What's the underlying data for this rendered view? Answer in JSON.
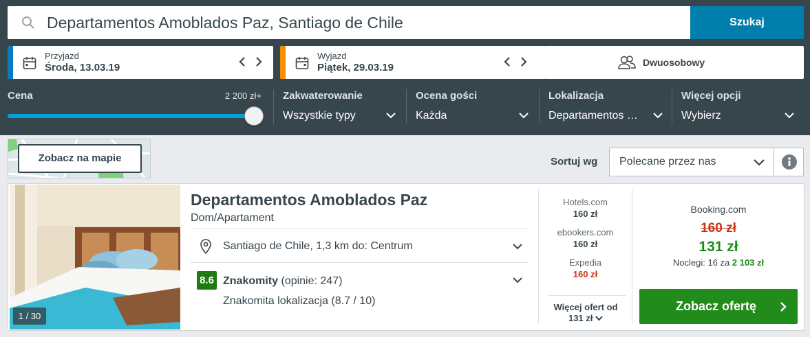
{
  "search": {
    "query": "Departamentos Amoblados Paz, Santiago de Chile",
    "button_label": "Szukaj"
  },
  "checkin": {
    "label": "Przyjazd",
    "date": "Środa, 13.03.19",
    "accent": "#0a7bbf"
  },
  "checkout": {
    "label": "Wyjazd",
    "date": "Piątek, 29.03.19",
    "accent": "#f48f00"
  },
  "guests": {
    "label": "Dwuosobowy"
  },
  "filters": {
    "price": {
      "label": "Cena",
      "max_label": "2 200 zł+",
      "level": 1.0
    },
    "accommodation": {
      "label": "Zakwaterowanie",
      "value": "Wszystkie typy"
    },
    "rating": {
      "label": "Ocena gości",
      "value": "Każda"
    },
    "location": {
      "label": "Lokalizacja",
      "value": "Departamentos …"
    },
    "more": {
      "label": "Więcej opcji",
      "value": "Wybierz"
    }
  },
  "map": {
    "button_label": "Zobacz na mapie"
  },
  "sort": {
    "label": "Sortuj wg",
    "value": "Polecane przez nas"
  },
  "hotel": {
    "name": "Departamentos Amoblados Paz",
    "type": "Dom/Apartament",
    "photo_counter": "1 / 30",
    "location": "Santiago de Chile, 1,3 km do: Centrum",
    "score": "8.6",
    "rating_word": "Znakomity",
    "reviews": "(opinie: 247)",
    "location_rating": "Znakomita lokalizacja (8.7 / 10)"
  },
  "other_prices": [
    {
      "site": "Hotels.com",
      "price": "160 zł"
    },
    {
      "site": "ebookers.com",
      "price": "160 zł"
    },
    {
      "site": "Expedia",
      "price": "160 zł"
    }
  ],
  "more_offers": {
    "line1": "Więcej ofert od",
    "line2": "131 zł"
  },
  "main_offer": {
    "site": "Booking.com",
    "old_price": "160 zł",
    "price": "131 zł",
    "nights_text": "Noclegi: 16 za",
    "total": "2 103 zł",
    "button_label": "Zobacz ofertę"
  },
  "colors": {
    "primary": "#007fad",
    "cta": "#218c1b",
    "strike": "#c9331a",
    "header": "#37454d"
  }
}
